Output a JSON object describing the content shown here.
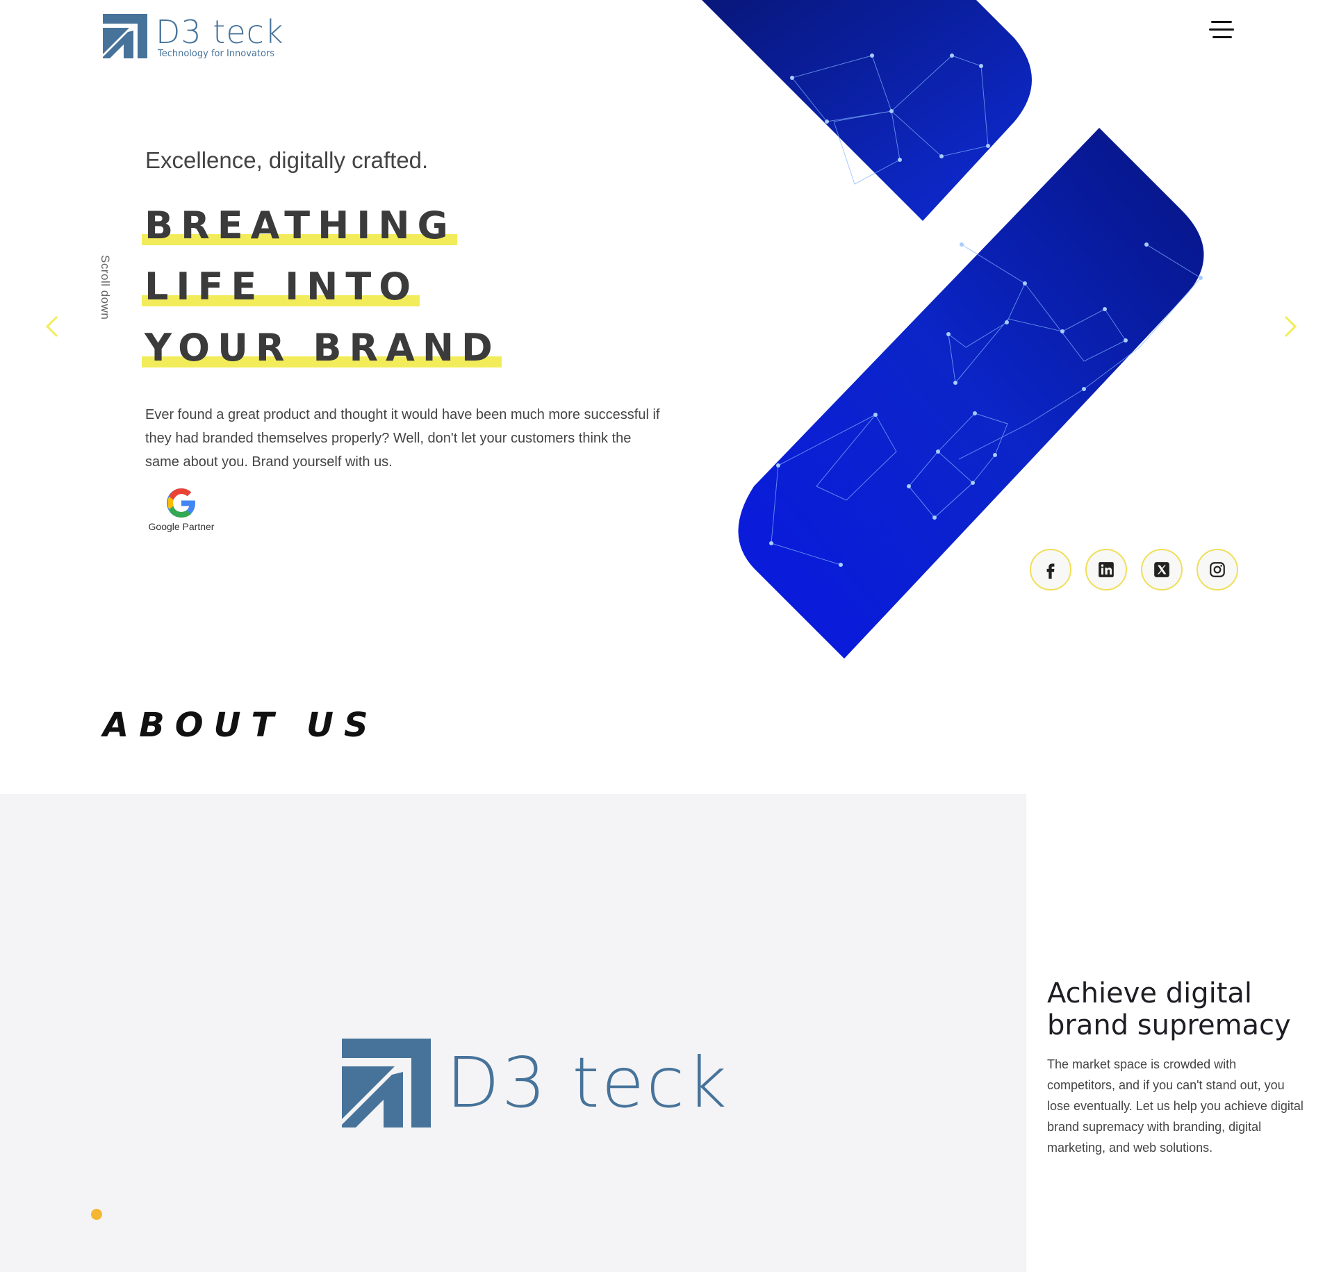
{
  "header": {
    "logo_name": "D3 teck",
    "logo_tagline": "Technology for Innovators"
  },
  "hero": {
    "subtitle": "Excellence, digitally crafted.",
    "title_lines": [
      "BREATHING",
      "LIFE INTO",
      "YOUR BRAND"
    ],
    "scroll_label": "Scroll down",
    "description": "Ever found a great product and thought it would have been much more successful if they had branded themselves properly? Well, don't let your customers think the same about you. Brand yourself with us.",
    "badge_label": "Google Partner"
  },
  "social": [
    "facebook-icon",
    "linkedin-icon",
    "x-icon",
    "instagram-icon"
  ],
  "about": {
    "heading": "ABOUT US",
    "logo_name": "D3 teck",
    "card_title": "Achieve digital brand supremacy",
    "card_text": "The market space is crowded with competitors, and if you can't stand out, you lose eventually. Let us help you achieve digital brand supremacy with branding, digital marketing, and web solutions."
  },
  "colors": {
    "brand": "#47739a",
    "highlight": "#f2ec5a",
    "accent_dot": "#f5b731",
    "network_blue": "#0a1fd0",
    "panel_bg": "#f4f4f6"
  }
}
